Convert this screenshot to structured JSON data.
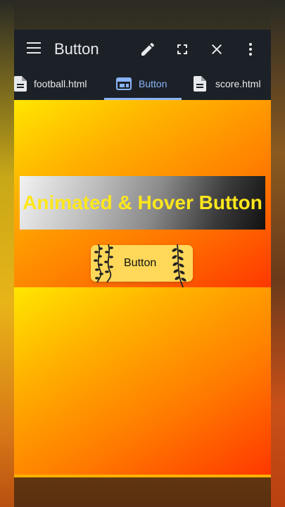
{
  "toolbar": {
    "title": "Button",
    "icons": [
      "menu-icon",
      "edit-icon",
      "fullscreen-icon",
      "close-icon",
      "more-vert-icon"
    ]
  },
  "tabs": [
    {
      "label": "football.html",
      "icon": "file-icon",
      "active": false
    },
    {
      "label": "Button",
      "icon": "web-icon",
      "active": true
    },
    {
      "label": "score.html",
      "icon": "file-icon",
      "active": false
    }
  ],
  "preview": {
    "heading": "Animated & Hover Button",
    "button_label": "Button"
  },
  "colors": {
    "accent": "#8ab4f8",
    "toolbar_bg": "#1c2128",
    "heading_text": "#ffe71c",
    "button_bg": "#ffd85a"
  }
}
